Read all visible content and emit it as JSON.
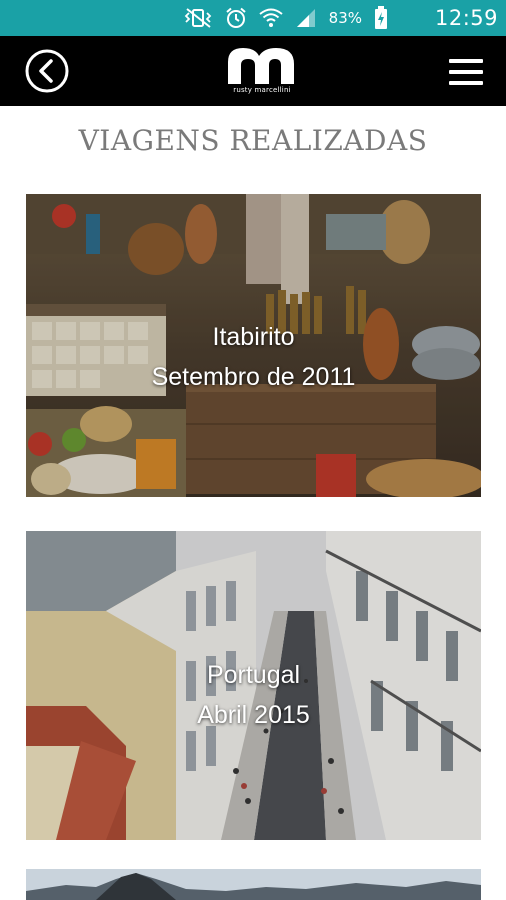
{
  "status_bar": {
    "battery_percent": "83%",
    "time": "12:59",
    "icons": [
      "vibrate-icon",
      "alarm-icon",
      "wifi-icon",
      "signal-icon",
      "battery-charging-icon"
    ],
    "background_color": "#1aa1a6"
  },
  "app_bar": {
    "logo_caption": "rusty marcellini",
    "back_icon": "back-arrow-icon",
    "menu_icon": "hamburger-menu-icon",
    "background_color": "#000000"
  },
  "page": {
    "title": "VIAGENS REALIZADAS"
  },
  "trips": [
    {
      "place": "Itabirito",
      "date": "Setembro de 2011",
      "photo": "market-stall-photo"
    },
    {
      "place": "Portugal",
      "date": "Abril 2015",
      "photo": "lisbon-street-photo"
    },
    {
      "place": "",
      "date": "",
      "photo": "mountain-landscape-photo"
    }
  ]
}
